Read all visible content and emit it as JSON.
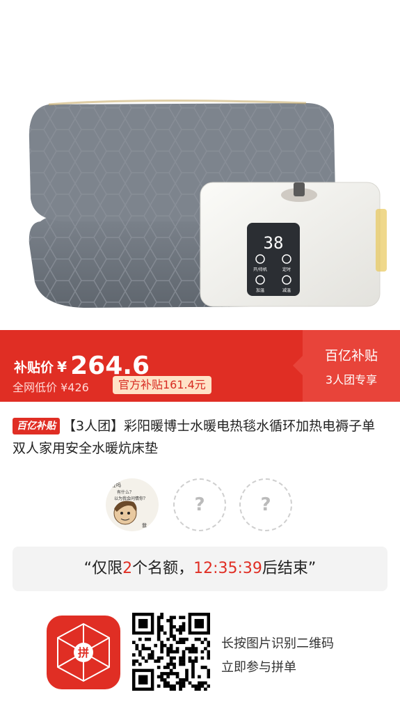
{
  "product": {
    "hero_icon": "electric-blanket-product-image",
    "display_temp": "38",
    "control_labels": [
      "开/待机",
      "定时",
      "加温",
      "减温"
    ]
  },
  "price": {
    "label": "补贴价",
    "currency": "¥",
    "value": "264.6",
    "original_label": "全网低价 ¥426",
    "subsidy": "官方补贴161.4元",
    "tag_title": "百亿补贴",
    "tag_subtitle": "3人团专享"
  },
  "title": {
    "badge": "百亿补贴",
    "text": "【3人团】彩阳暖博士水暖电热毯水循环加热电褥子单双人家用安全水暖炕床垫"
  },
  "group": {
    "empty_slot": "?",
    "avatar_caption_lines": [
      "在吗",
      "有什么？",
      "以为我会问情你？",
      "我"
    ]
  },
  "quota": {
    "prefix": "“仅限",
    "count": "2",
    "middle": "个名额，",
    "time": "12:35:39",
    "suffix": "后结束”"
  },
  "qr": {
    "line1": "长按图片识别二维码",
    "line2": "立即参与拼单",
    "app_icon_text": "拼"
  },
  "colors": {
    "brand_red": "#e02e24",
    "tag_red": "#e8443a"
  }
}
